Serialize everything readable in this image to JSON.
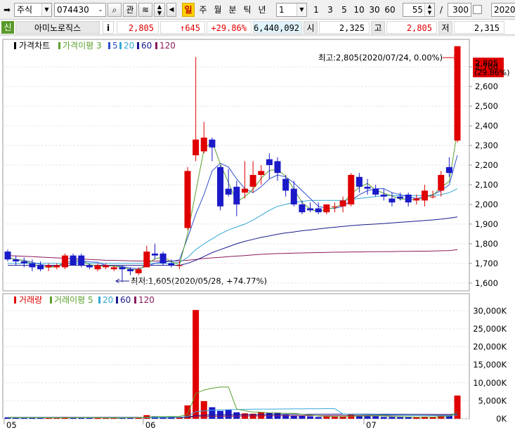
{
  "toolbar": {
    "type_value": "주식",
    "code_value": "074430",
    "gwan_label": "관",
    "hl_label": "일",
    "periods": [
      "주",
      "월",
      "분",
      "틱",
      "년"
    ],
    "period_unit_value": "1",
    "quick_periods": [
      "1",
      "3",
      "5",
      "10",
      "30",
      "60"
    ],
    "count_value": "55",
    "slash": "/",
    "total_value": "300",
    "date_value": "2020/"
  },
  "quote": {
    "badge": "신",
    "name": "아미노로직스",
    "info_label": "i",
    "price": "2,805",
    "change": "↑645",
    "rate": "+29.86%",
    "volume": "6,440,092",
    "open_label": "시",
    "open": "2,325",
    "high_label": "고",
    "high": "2,805",
    "low_label": "저",
    "low": "2,315"
  },
  "price_panel": {
    "legend_title": "가격차트",
    "legend_ma_label": "가격이평 3",
    "legend_ma": [
      "5",
      "20",
      "60",
      "120"
    ],
    "legend_colors": [
      "#2f4fcf",
      "#33a8d6",
      "#1a1a8c",
      "#8b1a5a"
    ],
    "high_annotation": "최고:2,805(2020/07/24, 0.00%)",
    "low_annotation": "최저:1,605(2020/05/28, +74.77%)",
    "current_price": "2,805",
    "current_rate": "(29.86%)",
    "y_ticks": [
      "2,700",
      "2,600",
      "2,500",
      "2,400",
      "2,300",
      "2,200",
      "2,100",
      "2,000",
      "1,900",
      "1,800",
      "1,700",
      "1,600"
    ]
  },
  "volume_panel": {
    "legend_title": "거래량",
    "legend_ma_label": "거래이평 5",
    "legend_ma": [
      "20",
      "60",
      "120"
    ],
    "y_ticks": [
      "30,000K",
      "25,000K",
      "20,000K",
      "15,000K",
      "10,000K",
      "5,000K",
      "0K"
    ]
  },
  "x_ticks": [
    "05",
    "06",
    "07"
  ],
  "colors": {
    "up": "#e00000",
    "down": "#1a1ac8",
    "ma3": "#5aa02c",
    "ma120": "#8b1a5a"
  },
  "chart_data": {
    "type": "candlestick",
    "x_labels": [
      "05",
      "06",
      "07"
    ],
    "candles": [
      {
        "o": 1760,
        "h": 1770,
        "l": 1710,
        "c": 1720
      },
      {
        "o": 1720,
        "h": 1740,
        "l": 1690,
        "c": 1710
      },
      {
        "o": 1710,
        "h": 1730,
        "l": 1680,
        "c": 1700
      },
      {
        "o": 1700,
        "h": 1720,
        "l": 1660,
        "c": 1680
      },
      {
        "o": 1690,
        "h": 1710,
        "l": 1660,
        "c": 1670
      },
      {
        "o": 1680,
        "h": 1700,
        "l": 1660,
        "c": 1690
      },
      {
        "o": 1680,
        "h": 1700,
        "l": 1670,
        "c": 1690
      },
      {
        "o": 1680,
        "h": 1750,
        "l": 1670,
        "c": 1740
      },
      {
        "o": 1740,
        "h": 1750,
        "l": 1690,
        "c": 1690
      },
      {
        "o": 1740,
        "h": 1750,
        "l": 1680,
        "c": 1690
      },
      {
        "o": 1690,
        "h": 1700,
        "l": 1670,
        "c": 1680
      },
      {
        "o": 1670,
        "h": 1700,
        "l": 1660,
        "c": 1690
      },
      {
        "o": 1680,
        "h": 1700,
        "l": 1670,
        "c": 1690
      },
      {
        "o": 1670,
        "h": 1690,
        "l": 1660,
        "c": 1680
      },
      {
        "o": 1680,
        "h": 1690,
        "l": 1605,
        "c": 1670
      },
      {
        "o": 1670,
        "h": 1680,
        "l": 1640,
        "c": 1660
      },
      {
        "o": 1650,
        "h": 1680,
        "l": 1640,
        "c": 1670
      },
      {
        "o": 1680,
        "h": 1790,
        "l": 1680,
        "c": 1760
      },
      {
        "o": 1750,
        "h": 1800,
        "l": 1720,
        "c": 1740
      },
      {
        "o": 1750,
        "h": 1760,
        "l": 1690,
        "c": 1700
      },
      {
        "o": 1700,
        "h": 1720,
        "l": 1680,
        "c": 1690
      },
      {
        "o": 1690,
        "h": 1710,
        "l": 1670,
        "c": 1690
      },
      {
        "o": 1880,
        "h": 2190,
        "l": 1870,
        "c": 2170
      },
      {
        "o": 2250,
        "h": 2750,
        "l": 2220,
        "c": 2330
      },
      {
        "o": 2270,
        "h": 2420,
        "l": 2260,
        "c": 2340
      },
      {
        "o": 2330,
        "h": 2340,
        "l": 2220,
        "c": 2290
      },
      {
        "o": 2190,
        "h": 2200,
        "l": 1970,
        "c": 1990
      },
      {
        "o": 2080,
        "h": 2180,
        "l": 2040,
        "c": 2050
      },
      {
        "o": 2090,
        "h": 2120,
        "l": 1940,
        "c": 2000
      },
      {
        "o": 2060,
        "h": 2220,
        "l": 2030,
        "c": 2080
      },
      {
        "o": 2090,
        "h": 2220,
        "l": 2060,
        "c": 2150
      },
      {
        "o": 2150,
        "h": 2200,
        "l": 2100,
        "c": 2170
      },
      {
        "o": 2230,
        "h": 2260,
        "l": 2130,
        "c": 2200
      },
      {
        "o": 2220,
        "h": 2240,
        "l": 2120,
        "c": 2160
      },
      {
        "o": 2130,
        "h": 2150,
        "l": 2040,
        "c": 2070
      },
      {
        "o": 2080,
        "h": 2120,
        "l": 1990,
        "c": 2000
      },
      {
        "o": 2000,
        "h": 2020,
        "l": 1950,
        "c": 1960
      },
      {
        "o": 1980,
        "h": 2010,
        "l": 1960,
        "c": 1970
      },
      {
        "o": 1980,
        "h": 2010,
        "l": 1950,
        "c": 1960
      },
      {
        "o": 1960,
        "h": 2000,
        "l": 1950,
        "c": 2000
      },
      {
        "o": 1990,
        "h": 2010,
        "l": 1960,
        "c": 1990
      },
      {
        "o": 1990,
        "h": 2040,
        "l": 1960,
        "c": 2020
      },
      {
        "o": 2000,
        "h": 2160,
        "l": 1990,
        "c": 2150
      },
      {
        "o": 2140,
        "h": 2160,
        "l": 2060,
        "c": 2090
      },
      {
        "o": 2090,
        "h": 2130,
        "l": 2050,
        "c": 2080
      },
      {
        "o": 2080,
        "h": 2100,
        "l": 2040,
        "c": 2050
      },
      {
        "o": 2050,
        "h": 2080,
        "l": 2020,
        "c": 2040
      },
      {
        "o": 2030,
        "h": 2060,
        "l": 1990,
        "c": 2010
      },
      {
        "o": 2040,
        "h": 2060,
        "l": 2020,
        "c": 2030
      },
      {
        "o": 2050,
        "h": 2060,
        "l": 1990,
        "c": 2010
      },
      {
        "o": 2020,
        "h": 2050,
        "l": 2000,
        "c": 2030
      },
      {
        "o": 2020,
        "h": 2100,
        "l": 1990,
        "c": 2070
      },
      {
        "o": 2040,
        "h": 2070,
        "l": 2030,
        "c": 2040
      },
      {
        "o": 2070,
        "h": 2170,
        "l": 2040,
        "c": 2150
      },
      {
        "o": 2190,
        "h": 2240,
        "l": 2140,
        "c": 2160
      },
      {
        "o": 2325,
        "h": 2805,
        "l": 2315,
        "c": 2805
      }
    ],
    "volumes": [
      400,
      300,
      250,
      350,
      300,
      250,
      200,
      500,
      350,
      300,
      250,
      250,
      250,
      250,
      300,
      400,
      350,
      1000,
      700,
      500,
      600,
      400,
      3700,
      30200,
      4900,
      3200,
      2200,
      2500,
      1800,
      1500,
      1400,
      1800,
      1600,
      1700,
      1100,
      900,
      800,
      650,
      500,
      600,
      550,
      600,
      1300,
      800,
      700,
      700,
      500,
      500,
      450,
      400,
      400,
      600,
      400,
      900,
      1000,
      6440
    ],
    "ma": {
      "price_ma3": [
        1730,
        1720,
        1713,
        1697,
        1683,
        1680,
        1683,
        1707,
        1713,
        1718,
        1693,
        1687,
        1687,
        1686,
        1680,
        1670,
        1667,
        1697,
        1723,
        1733,
        1710,
        1693,
        1850,
        2063,
        2280,
        2320,
        2207,
        2110,
        2013,
        2040,
        2077,
        2133,
        2173,
        2177,
        2143,
        2077,
        2010,
        1977,
        1963,
        1977,
        1983,
        2003,
        2053,
        2087,
        2107,
        2073,
        2057,
        2043,
        2027,
        2027,
        2023,
        2037,
        2047,
        2087,
        2117,
        2373
      ],
      "price_ma5": [
        1730,
        1720,
        1715,
        1705,
        1695,
        1686,
        1686,
        1698,
        1704,
        1712,
        1708,
        1706,
        1690,
        1686,
        1684,
        1676,
        1673,
        1685,
        1701,
        1708,
        1710,
        1718,
        1830,
        1950,
        2050,
        2170,
        2210,
        2190,
        2130,
        2080,
        2060,
        2090,
        2130,
        2150,
        2140,
        2110,
        2070,
        2030,
        1990,
        1980,
        1980,
        1990,
        2020,
        2050,
        2070,
        2080,
        2080,
        2060,
        2050,
        2040,
        2030,
        2040,
        2050,
        2070,
        2100,
        2250
      ],
      "price_ma20": [
        1700,
        1700,
        1700,
        1700,
        1700,
        1700,
        1700,
        1700,
        1700,
        1700,
        1700,
        1700,
        1700,
        1700,
        1700,
        1700,
        1700,
        1700,
        1700,
        1700,
        1700,
        1705,
        1730,
        1770,
        1800,
        1825,
        1850,
        1870,
        1885,
        1900,
        1920,
        1945,
        1970,
        1990,
        2000,
        2010,
        2015,
        2020,
        2020,
        2020,
        2020,
        2020,
        2025,
        2030,
        2035,
        2040,
        2045,
        2045,
        2045,
        2045,
        2045,
        2045,
        2045,
        2050,
        2060,
        2080
      ],
      "price_ma60": [
        1690,
        1690,
        1690,
        1690,
        1690,
        1690,
        1690,
        1690,
        1690,
        1690,
        1690,
        1690,
        1690,
        1690,
        1690,
        1690,
        1690,
        1690,
        1690,
        1690,
        1690,
        1690,
        1700,
        1715,
        1735,
        1755,
        1770,
        1785,
        1800,
        1812,
        1822,
        1832,
        1840,
        1848,
        1855,
        1860,
        1866,
        1870,
        1875,
        1880,
        1884,
        1888,
        1892,
        1895,
        1898,
        1900,
        1903,
        1906,
        1909,
        1912,
        1915,
        1918,
        1921,
        1925,
        1930,
        1936
      ],
      "price_ma120": [
        1740,
        1738,
        1736,
        1734,
        1732,
        1730,
        1728,
        1726,
        1724,
        1722,
        1720,
        1718,
        1716,
        1715,
        1714,
        1713,
        1712,
        1712,
        1712,
        1712,
        1712,
        1713,
        1716,
        1720,
        1725,
        1728,
        1731,
        1734,
        1737,
        1740,
        1743,
        1746,
        1748,
        1750,
        1751,
        1752,
        1753,
        1754,
        1755,
        1756,
        1757,
        1757,
        1758,
        1758,
        1759,
        1759,
        1760,
        1760,
        1761,
        1761,
        1762,
        1762,
        1763,
        1764,
        1765,
        1770
      ],
      "volume_ma5": [
        350,
        340,
        320,
        320,
        300,
        280,
        260,
        300,
        300,
        320,
        330,
        310,
        260,
        250,
        260,
        290,
        310,
        470,
        560,
        590,
        630,
        640,
        1250,
        7000,
        7980,
        8480,
        8800,
        8800,
        2720,
        2240,
        1880,
        1840,
        1660,
        1600,
        1520,
        1500,
        1240,
        1030,
        800,
        690,
        620,
        580,
        720,
        770,
        790,
        820,
        800,
        640,
        570,
        510,
        450,
        470,
        470,
        560,
        660,
        1870
      ],
      "volume_ma20": [
        350,
        350,
        350,
        350,
        340,
        330,
        320,
        320,
        320,
        320,
        320,
        320,
        320,
        320,
        320,
        320,
        320,
        350,
        380,
        400,
        420,
        430,
        600,
        2000,
        2200,
        2350,
        2450,
        2520,
        2580,
        2620,
        2650,
        2680,
        2700,
        2720,
        2740,
        2750,
        2760,
        2770,
        2780,
        2800,
        2800,
        1300,
        1250,
        1200,
        1180,
        1160,
        1100,
        1050,
        1000,
        950,
        900,
        880,
        860,
        850,
        860,
        1100
      ],
      "volume_ma60": [
        380,
        380,
        380,
        380,
        380,
        380,
        380,
        380,
        380,
        380,
        380,
        380,
        380,
        380,
        380,
        380,
        380,
        380,
        380,
        380,
        380,
        380,
        400,
        900,
        1000,
        1050,
        1080,
        1100,
        1120,
        1140,
        1160,
        1180,
        1200,
        1210,
        1220,
        1230,
        1240,
        1250,
        1260,
        1270,
        1280,
        1280,
        1280,
        1280,
        1280,
        1270,
        1260,
        1250,
        1240,
        1230,
        1220,
        1210,
        1200,
        1200,
        1200,
        1300
      ],
      "volume_ma120": [
        400,
        400,
        400,
        400,
        400,
        400,
        400,
        400,
        400,
        400,
        400,
        400,
        400,
        400,
        400,
        400,
        400,
        400,
        400,
        400,
        400,
        400,
        420,
        600,
        650,
        680,
        700,
        720,
        740,
        760,
        780,
        800,
        810,
        820,
        830,
        840,
        850,
        860,
        870,
        880,
        890,
        895,
        900,
        905,
        910,
        915,
        920,
        925,
        930,
        935,
        940,
        945,
        950,
        955,
        960,
        1000
      ]
    },
    "price_ylim": [
      1560,
      2840
    ],
    "volume_ylim": [
      0,
      32000
    ],
    "volume_unit": "K"
  }
}
